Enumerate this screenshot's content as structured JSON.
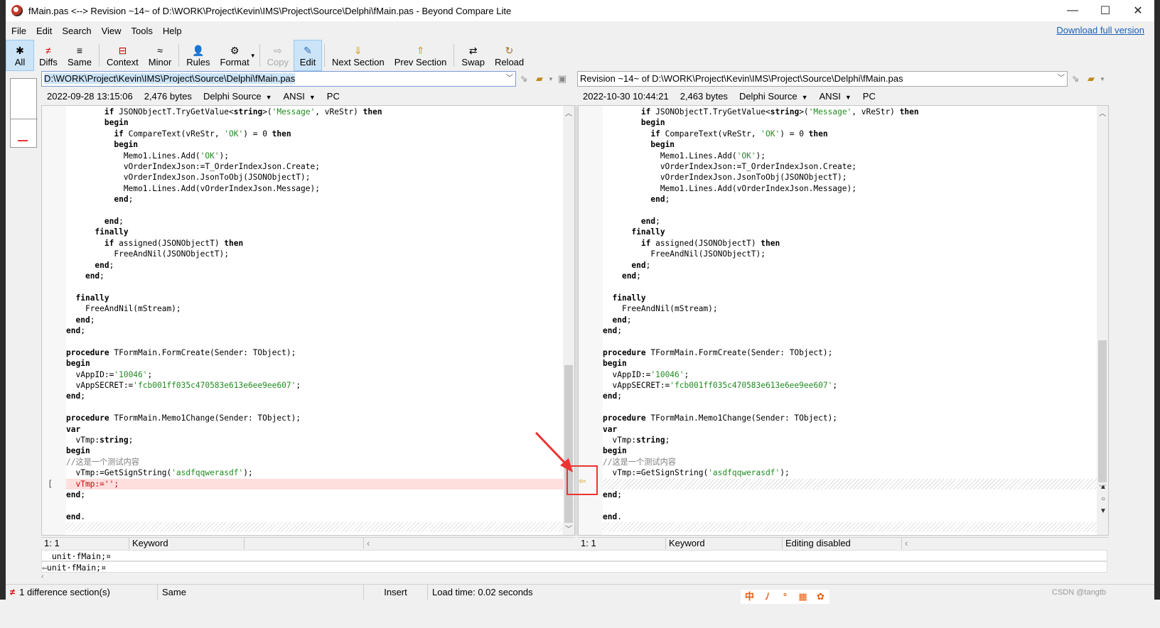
{
  "window": {
    "title": "fMain.pas <--> Revision ~14~ of D:\\WORK\\Project\\Kevin\\IMS\\Project\\Source\\Delphi\\fMain.pas - Beyond Compare Lite",
    "minimize_glyph": "—",
    "maximize_glyph": "☐",
    "close_glyph": "✕"
  },
  "menu": [
    "File",
    "Edit",
    "Search",
    "View",
    "Tools",
    "Help"
  ],
  "download_link": "Download full version",
  "toolbar": {
    "buttons": [
      {
        "label": "All",
        "icon": "✱",
        "icon_name": "asterisk-icon",
        "state": "active"
      },
      {
        "label": "Diffs",
        "icon": "≠",
        "icon_name": "not-equal-icon",
        "state": "normal"
      },
      {
        "label": "Same",
        "icon": "≡",
        "icon_name": "equal-icon",
        "state": "normal"
      },
      {
        "label": "Context",
        "icon": "⊟",
        "icon_name": "context-icon",
        "state": "normal"
      },
      {
        "label": "Minor",
        "icon": "≈",
        "icon_name": "approx-icon",
        "state": "normal"
      },
      {
        "label": "Rules",
        "icon": "👤",
        "icon_name": "rules-icon",
        "state": "normal"
      },
      {
        "label": "Format",
        "icon": "⚙",
        "icon_name": "format-icon",
        "state": "normal"
      },
      {
        "label": "Copy",
        "icon": "⇨",
        "icon_name": "copy-icon",
        "state": "disabled"
      },
      {
        "label": "Edit",
        "icon": "✎",
        "icon_name": "edit-icon",
        "state": "active"
      },
      {
        "label": "Next Section",
        "icon": "⇓",
        "icon_name": "next-section-icon",
        "state": "normal"
      },
      {
        "label": "Prev Section",
        "icon": "⇑",
        "icon_name": "prev-section-icon",
        "state": "normal"
      },
      {
        "label": "Swap",
        "icon": "⇄",
        "icon_name": "swap-icon",
        "state": "normal"
      },
      {
        "label": "Reload",
        "icon": "↻",
        "icon_name": "reload-icon",
        "state": "normal"
      }
    ]
  },
  "left": {
    "path": "D:\\WORK\\Project\\Kevin\\IMS\\Project\\Source\\Delphi\\fMain.pas",
    "date": "2022-09-28 13:15:06",
    "size": "2,476 bytes",
    "format": "Delphi Source",
    "encoding": "ANSI",
    "line_ending": "PC",
    "status_pos": "1: 1",
    "status_type": "Keyword",
    "status_extra": ""
  },
  "right": {
    "path": "Revision ~14~ of D:\\WORK\\Project\\Kevin\\IMS\\Project\\Source\\Delphi\\fMain.pas",
    "date": "2022-10-30 10:44:21",
    "size": "2,463 bytes",
    "format": "Delphi Source",
    "encoding": "ANSI",
    "line_ending": "PC",
    "status_pos": "1: 1",
    "status_type": "Keyword",
    "status_extra": "Editing disabled"
  },
  "code_common": [
    "        if JSONObjectT.TryGetValue<string>('Message', vReStr) then",
    "        begin",
    "          if CompareText(vReStr, 'OK') = 0 then",
    "          begin",
    "            Memo1.Lines.Add('OK');",
    "            vOrderIndexJson:=T_OrderIndexJson.Create;",
    "            vOrderIndexJson.JsonToObj(JSONObjectT);",
    "            Memo1.Lines.Add(vOrderIndexJson.Message);",
    "          end;",
    "",
    "        end;",
    "      finally",
    "        if assigned(JSONObjectT) then",
    "          FreeAndNil(JSONObjectT);",
    "      end;",
    "    end;",
    "",
    "  finally",
    "    FreeAndNil(mStream);",
    "  end;",
    "end;",
    "",
    "procedure TFormMain.FormCreate(Sender: TObject);",
    "begin",
    "  vAppID:='10046';",
    "  vAppSECRET:='fcb001ff035c470583e613e6ee9ee607';",
    "end;",
    "",
    "procedure TFormMain.Memo1Change(Sender: TObject);",
    "var",
    "  vTmp:string;",
    "begin",
    "//这是一个测试内容",
    "  vTmp:=GetSignString('asdfqqwerasdf');"
  ],
  "diff_line_left": "  vTmp:='';",
  "code_tail": [
    "end;",
    "",
    "end."
  ],
  "line_compare": {
    "top": "  unit·fMain;¤",
    "bottom": "⇦unit·fMain;¤"
  },
  "status": {
    "diff_count": "1 difference section(s)",
    "same": "Same",
    "mode": "Insert",
    "load_time": "Load time: 0.02 seconds"
  },
  "ime": [
    "中",
    "ﾉ",
    "°",
    "▦",
    "✿"
  ],
  "watermark": "CSDN @tangtb"
}
